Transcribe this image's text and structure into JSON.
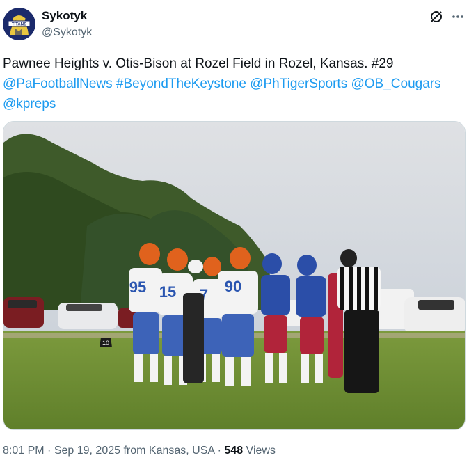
{
  "author": {
    "name": "Sykotyk",
    "handle": "@Sykotyk",
    "avatar_text": "TITANS"
  },
  "tweet": {
    "text": "Pawnee Heights v. Otis-Bison at Rozel Field in Rozel, Kansas. #29 ",
    "links": [
      "@PaFootballNews",
      "#BeyondTheKeystone",
      "@PhTigerSports",
      "@OB_Cougars",
      "@kpreps"
    ]
  },
  "media": {
    "jerseys": [
      "95",
      "15",
      "7",
      "90"
    ],
    "marker": "10"
  },
  "meta": {
    "time": "8:01 PM",
    "sep1": " · ",
    "date": "Sep 19, 2025",
    "location": " from Kansas, USA",
    "sep2": " · ",
    "views_count": "548",
    "views_label": " Views"
  },
  "colors": {
    "link": "#1d9bf0",
    "secondary_text": "#536471"
  },
  "icons": [
    "grok-icon",
    "more-icon"
  ]
}
